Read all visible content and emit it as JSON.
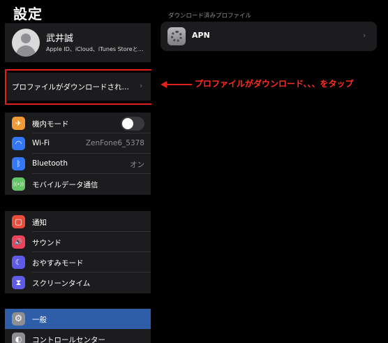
{
  "left": {
    "title": "設定",
    "profile": {
      "name": "武井誠",
      "subtitle": "Apple ID、iCloud、iTunes Storeと…"
    },
    "download_row": {
      "label": "プロファイルがダウンロードされ…",
      "chevron": "›"
    },
    "group1": [
      {
        "label": "機内モード",
        "icon": "airplane-icon",
        "color": "#f09a37",
        "glyph": "✈",
        "toggle": false
      },
      {
        "label": "Wi-Fi",
        "icon": "wifi-icon",
        "color": "#3478f6",
        "glyph": "◠",
        "value": "ZenFone6_5378"
      },
      {
        "label": "Bluetooth",
        "icon": "bluetooth-icon",
        "color": "#3478f6",
        "glyph": "ᛒ",
        "value": "オン"
      },
      {
        "label": "モバイルデータ通信",
        "icon": "cellular-icon",
        "color": "#65c466",
        "glyph": "((•))"
      }
    ],
    "group2": [
      {
        "label": "通知",
        "icon": "notifications-icon",
        "color": "#eb4d3d",
        "glyph": "▢"
      },
      {
        "label": "サウンド",
        "icon": "sound-icon",
        "color": "#eb445a",
        "glyph": "🔊"
      },
      {
        "label": "おやすみモード",
        "icon": "moon-icon",
        "color": "#5e5ce6",
        "glyph": "☾"
      },
      {
        "label": "スクリーンタイム",
        "icon": "hourglass-icon",
        "color": "#5e5ce6",
        "glyph": "⧗"
      }
    ],
    "group3": [
      {
        "label": "一般",
        "icon": "gear-icon",
        "color": "#8e8e93",
        "glyph": "⚙",
        "selected": true
      },
      {
        "label": "コントロールセンター",
        "icon": "control-center-icon",
        "color": "#8e8e93",
        "glyph": "◐"
      }
    ]
  },
  "right": {
    "section_header": "ダウンロード済みプロファイル",
    "apn": {
      "name": "APN",
      "chevron": "›"
    }
  },
  "annotation": {
    "text": "プロファイルがダウンロード、、、をタップ",
    "color": "#e0201b"
  }
}
